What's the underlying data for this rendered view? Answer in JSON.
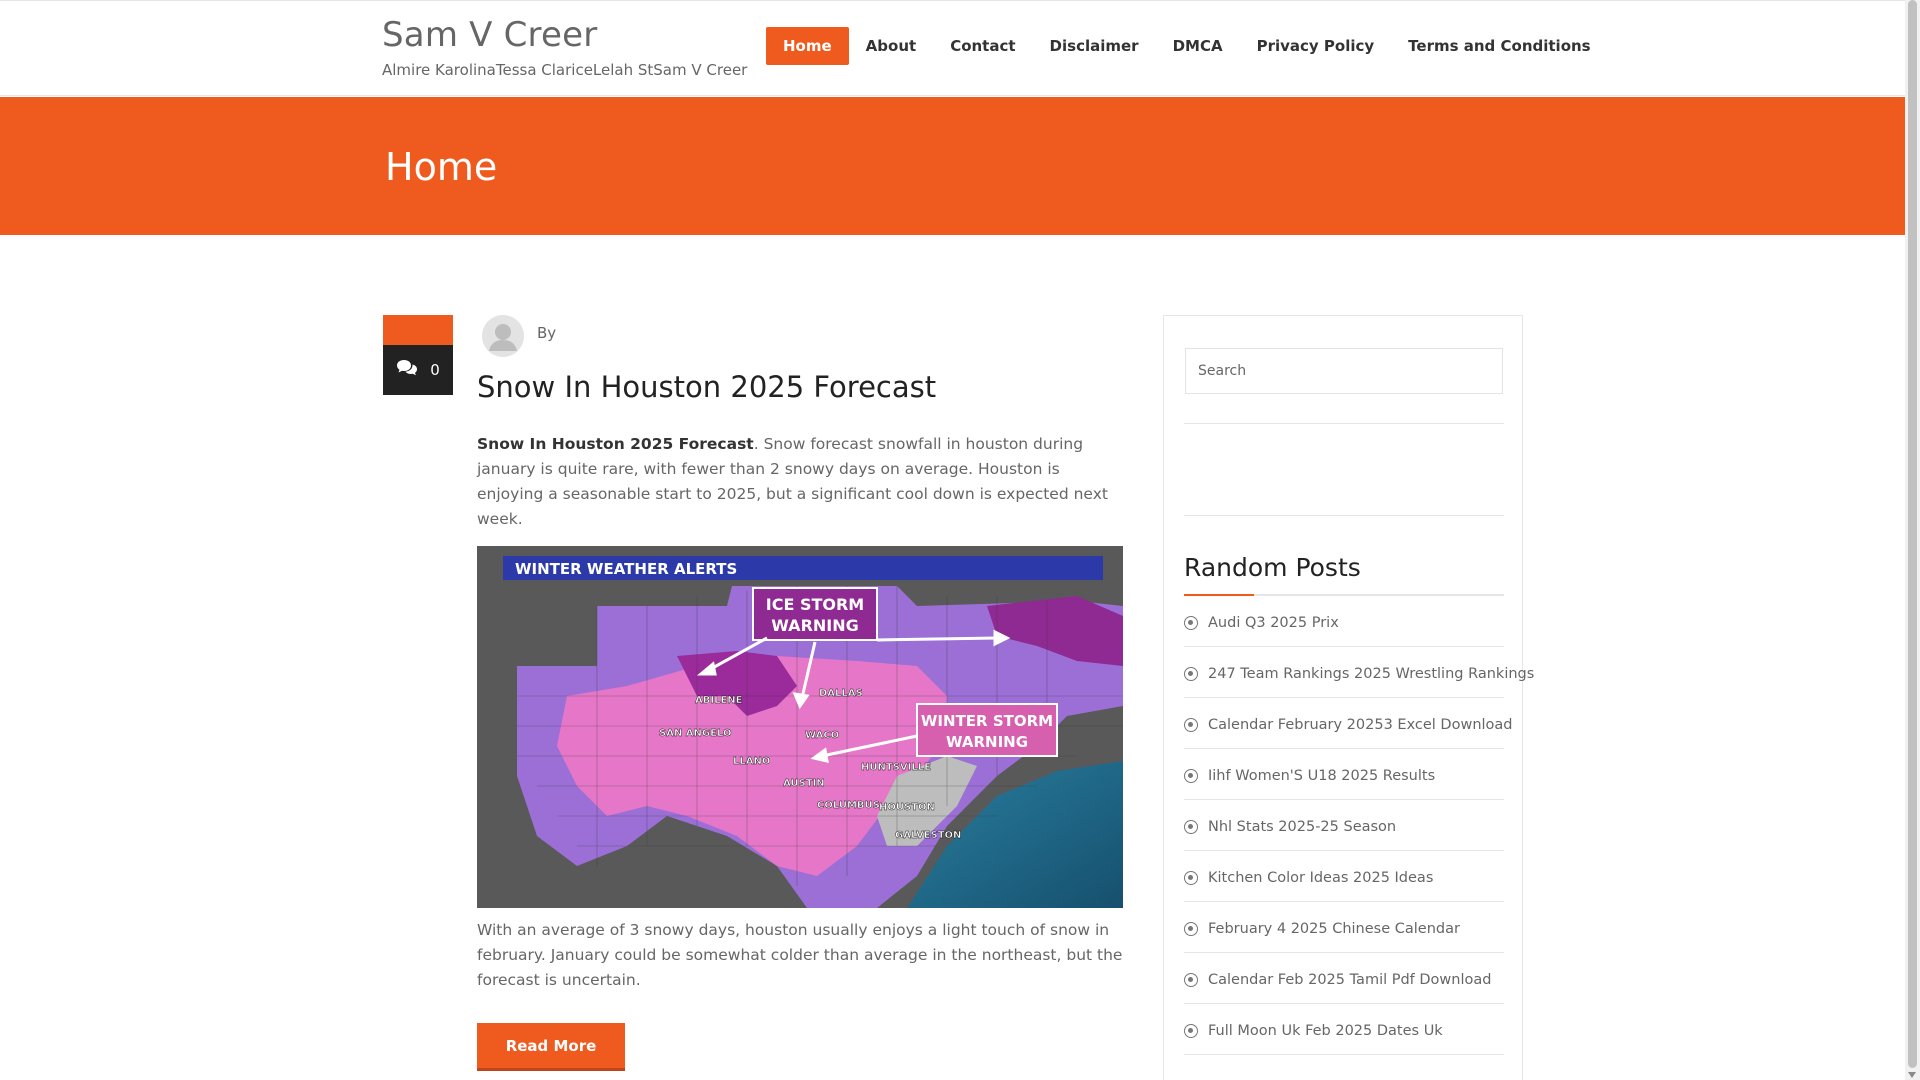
{
  "site": {
    "title": "Sam V Creer",
    "tagline": "Almire KarolinaTessa ClariceLelah StSam V Creer"
  },
  "nav": {
    "items": [
      "Home",
      "About",
      "Contact",
      "Disclaimer",
      "DMCA",
      "Privacy Policy",
      "Terms and Conditions"
    ],
    "active": "Home"
  },
  "banner": {
    "title": "Home"
  },
  "post": {
    "comments_count": "0",
    "by_label": "By",
    "title": "Snow In Houston 2025 Forecast",
    "lead_bold": "Snow In Houston 2025 Forecast",
    "lead_rest": ". Snow forecast  snowfall in houston during january is quite rare, with fewer than 2 snowy days on average. Houston is enjoying a seasonable start to 2025, but a significant cool down is expected next week.",
    "body": "With an average of 3 snowy days, houston usually enjoys a light touch of snow in february. January could be somewhat colder than average in the northeast, but the forecast is uncertain.",
    "read_more": "Read More",
    "image": {
      "header": "WINTER WEATHER ALERTS",
      "ice_label": "ICE STORM\nWARNING",
      "winter_label": "WINTER STORM\nWARNING",
      "cities": [
        "ABILENE",
        "DALLAS",
        "SAN ANGELO",
        "WACO",
        "LLANO",
        "HUNTSVILLE",
        "AUSTIN",
        "COLUMBUS",
        "HOUSTON",
        "GALVESTON"
      ]
    }
  },
  "sidebar": {
    "search_placeholder": "Search",
    "random_posts_title": "Random Posts",
    "random_posts": [
      "Audi Q3 2025 Prix",
      "247 Team Rankings 2025 Wrestling Rankings",
      "Calendar February 20253 Excel Download",
      "Iihf Women'S U18 2025 Results",
      "Nhl Stats 2025-25 Season",
      "Kitchen Color Ideas 2025 Ideas",
      "February 4 2025 Chinese Calendar",
      "Calendar Feb 2025 Tamil Pdf Download",
      "Full Moon Uk Feb 2025 Dates Uk"
    ]
  },
  "colors": {
    "accent": "#ef5a1f",
    "dark": "#222222"
  }
}
